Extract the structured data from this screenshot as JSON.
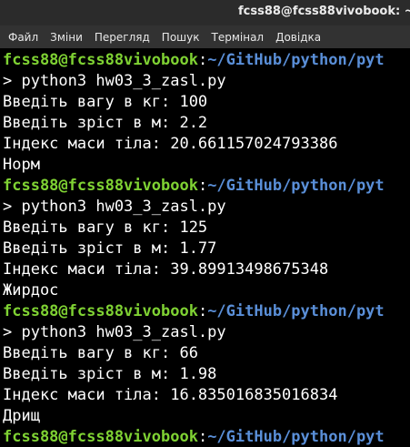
{
  "window": {
    "title": "fcss88@fcss88vivobook: ~"
  },
  "menubar": {
    "items": [
      "Файл",
      "Зміни",
      "Перегляд",
      "Пошук",
      "Термінал",
      "Довідка"
    ]
  },
  "terminal": {
    "prompt": {
      "user_host": "fcss88@fcss88vivobook",
      "separator": ":",
      "path": "~/GitHub/python/pyt"
    },
    "lines": [
      {
        "kind": "prompt"
      },
      {
        "kind": "text",
        "text": "> python3 hw03_3_zasl.py"
      },
      {
        "kind": "text",
        "text": "Введіть вагу в кг: 100"
      },
      {
        "kind": "text",
        "text": "Введіть зріст в м: 2.2"
      },
      {
        "kind": "text",
        "text": "Індекс маси тіла: 20.661157024793386"
      },
      {
        "kind": "text",
        "text": "Норм"
      },
      {
        "kind": "prompt"
      },
      {
        "kind": "text",
        "text": "> python3 hw03_3_zasl.py"
      },
      {
        "kind": "text",
        "text": "Введіть вагу в кг: 125"
      },
      {
        "kind": "text",
        "text": "Введіть зріст в м: 1.77"
      },
      {
        "kind": "text",
        "text": "Індекс маси тіла: 39.89913498675348"
      },
      {
        "kind": "text",
        "text": "Жирдос"
      },
      {
        "kind": "prompt"
      },
      {
        "kind": "text",
        "text": "> python3 hw03_3_zasl.py"
      },
      {
        "kind": "text",
        "text": "Введіть вагу в кг: 66"
      },
      {
        "kind": "text",
        "text": "Введіть зріст в м: 1.98"
      },
      {
        "kind": "text",
        "text": "Індекс маси тіла: 16.835016835016834"
      },
      {
        "kind": "text",
        "text": "Дрищ"
      },
      {
        "kind": "prompt"
      }
    ]
  },
  "colors": {
    "prompt_user": "#7fd233",
    "prompt_path": "#5a8fd8",
    "terminal_bg": "#000000",
    "text": "#ffffff",
    "titlebar_bg": "#2b2b2b",
    "menubar_bg": "#323232"
  }
}
